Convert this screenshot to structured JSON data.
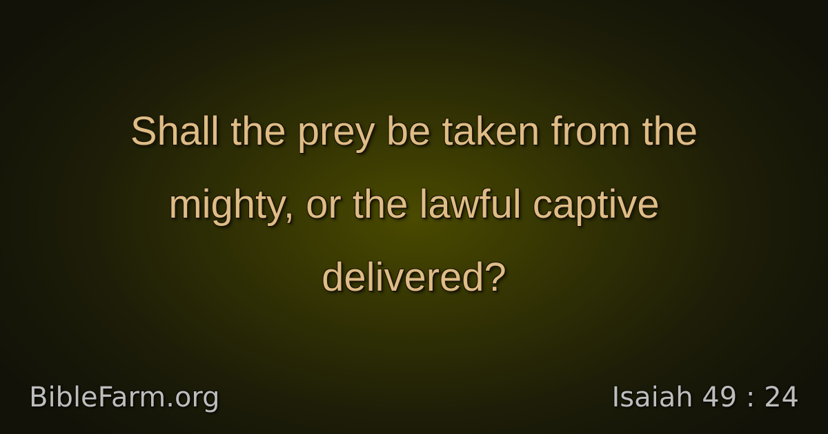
{
  "verse": {
    "lines": [
      "Shall the prey be taken from the",
      "mighty, or the lawful captive",
      "delivered?"
    ]
  },
  "footer": {
    "site": "BibleFarm.org",
    "reference": "Isaiah 49 : 24"
  },
  "colors": {
    "verse_text": "#dfbc86",
    "footer_text": "#bdbdbd",
    "background_center": "#4a4a00",
    "background_edge": "#121208"
  }
}
